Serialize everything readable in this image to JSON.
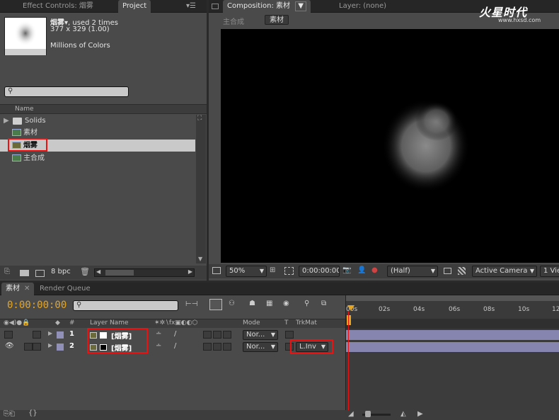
{
  "project_panel": {
    "tab_effect_controls": "Effect Controls: 烟雾",
    "tab_project": "Project",
    "item_name": "烟雾▾",
    "item_usage": ", used 2 times",
    "item_dims": "377 x 329 (1.00)",
    "item_colors": "Millions of Colors",
    "search_placeholder": "",
    "col_name": "Name",
    "items": [
      {
        "label": "Solids"
      },
      {
        "label": "素材"
      },
      {
        "label": "烟雾"
      },
      {
        "label": "主合成"
      }
    ],
    "bpc": "8 bpc"
  },
  "composition_panel": {
    "tab_composition": "Composition: 素材",
    "tab_layer": "Layer: (none)",
    "breadcrumb_main": "主合成",
    "breadcrumb_current": "素材",
    "zoom": "50%",
    "timecode": "0:00:00:00",
    "resolution": "(Half)",
    "camera": "Active Camera",
    "view": "1 Vie"
  },
  "watermark": {
    "brand": "火星时代",
    "url": "www.hxsd.com"
  },
  "timeline_panel": {
    "tab_comp": "素材",
    "tab_render": "Render Queue",
    "timecode": "0:00:00:00",
    "col_num": "#",
    "col_layer_name": "Layer Name",
    "col_mode": "Mode",
    "col_t": "T",
    "col_trkmat": "TrkMat",
    "ruler": [
      "00s",
      "02s",
      "04s",
      "06s",
      "08s",
      "10s",
      "12"
    ],
    "layers": [
      {
        "num": "1",
        "name": "[烟雾]",
        "mode": "Nor...",
        "trkmat": ""
      },
      {
        "num": "2",
        "name": "[烟雾]",
        "mode": "Nor...",
        "trkmat": "L.Inv"
      }
    ]
  }
}
